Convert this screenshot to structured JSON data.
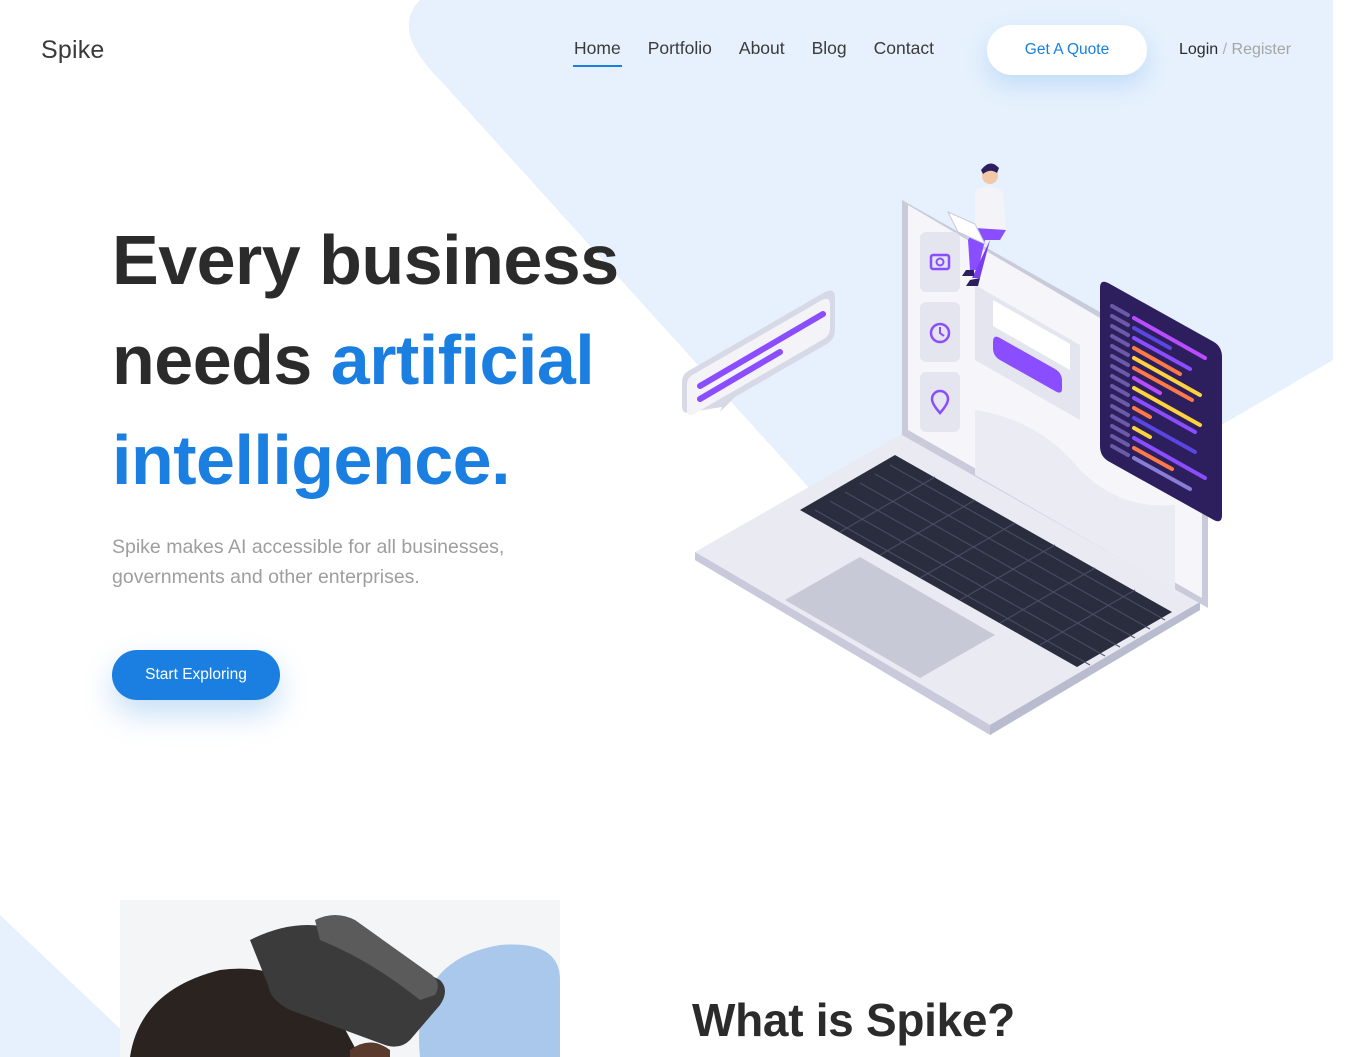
{
  "brand": {
    "name": "Spike"
  },
  "nav": {
    "items": [
      {
        "label": "Home",
        "active": true
      },
      {
        "label": "Portfolio",
        "active": false
      },
      {
        "label": "About",
        "active": false
      },
      {
        "label": "Blog",
        "active": false
      },
      {
        "label": "Contact",
        "active": false
      }
    ],
    "quote_label": "Get A Quote",
    "login_label": "Login",
    "separator": "/",
    "register_label": "Register"
  },
  "hero": {
    "title_line1": "Every business",
    "title_line2_plain": "needs ",
    "title_line2_accent": "artificial",
    "title_line3_accent": "intelligence.",
    "subtitle": "Spike makes AI accessible for all businesses, governments and other enterprises.",
    "cta_label": "Start Exploring"
  },
  "section2": {
    "title": "What is Spike?"
  },
  "colors": {
    "accent": "#1a7fe0",
    "bg_shape": "#e6f1fd",
    "purple": "#8a4dff",
    "code_bg": "#2d1f5e"
  },
  "icons": [
    "camera-icon",
    "clock-icon",
    "map-pin-icon"
  ]
}
